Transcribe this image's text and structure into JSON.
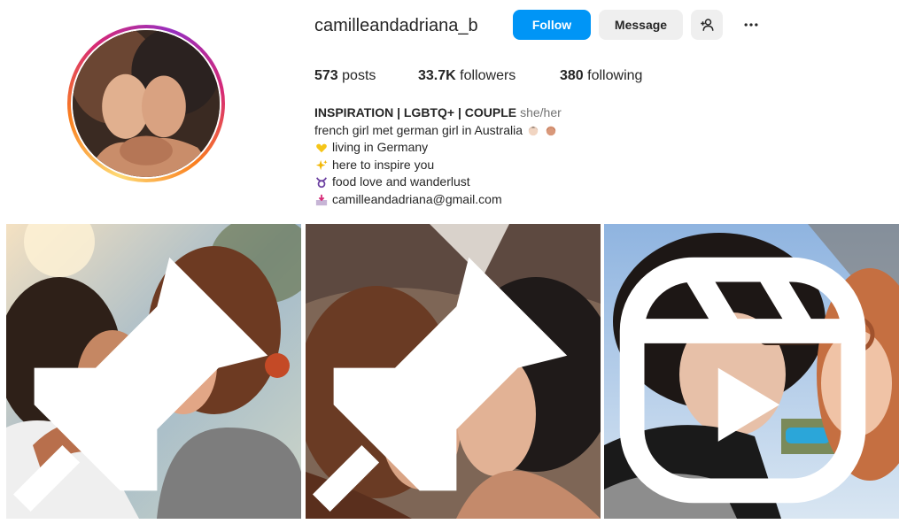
{
  "profile": {
    "username": "camilleandadriana_b",
    "follow_label": "Follow",
    "message_label": "Message",
    "posts_count": "573",
    "posts_label": "posts",
    "followers_count": "33.7K",
    "followers_label": "followers",
    "following_count": "380",
    "following_label": "following"
  },
  "bio": {
    "title": "INSPIRATION | LGBTQ+ | COUPLE",
    "pronouns": "she/her",
    "lines": [
      "french girl met german girl in Australia",
      "living in Germany",
      "here to inspire you",
      "food love and wanderlust",
      "camilleandadriana@gmail.com"
    ]
  },
  "icons": {
    "add_user": "add-user-icon",
    "more": "more-options-icon",
    "pinned": "pin-icon",
    "reel": "reel-icon"
  },
  "posts": [
    {
      "badge": "pin-icon"
    },
    {
      "badge": "pin-icon"
    },
    {
      "badge": "reel-icon"
    }
  ],
  "colors": {
    "accent": "#0095f6",
    "button_secondary": "#efefef",
    "text": "#262626",
    "muted": "#737373"
  }
}
